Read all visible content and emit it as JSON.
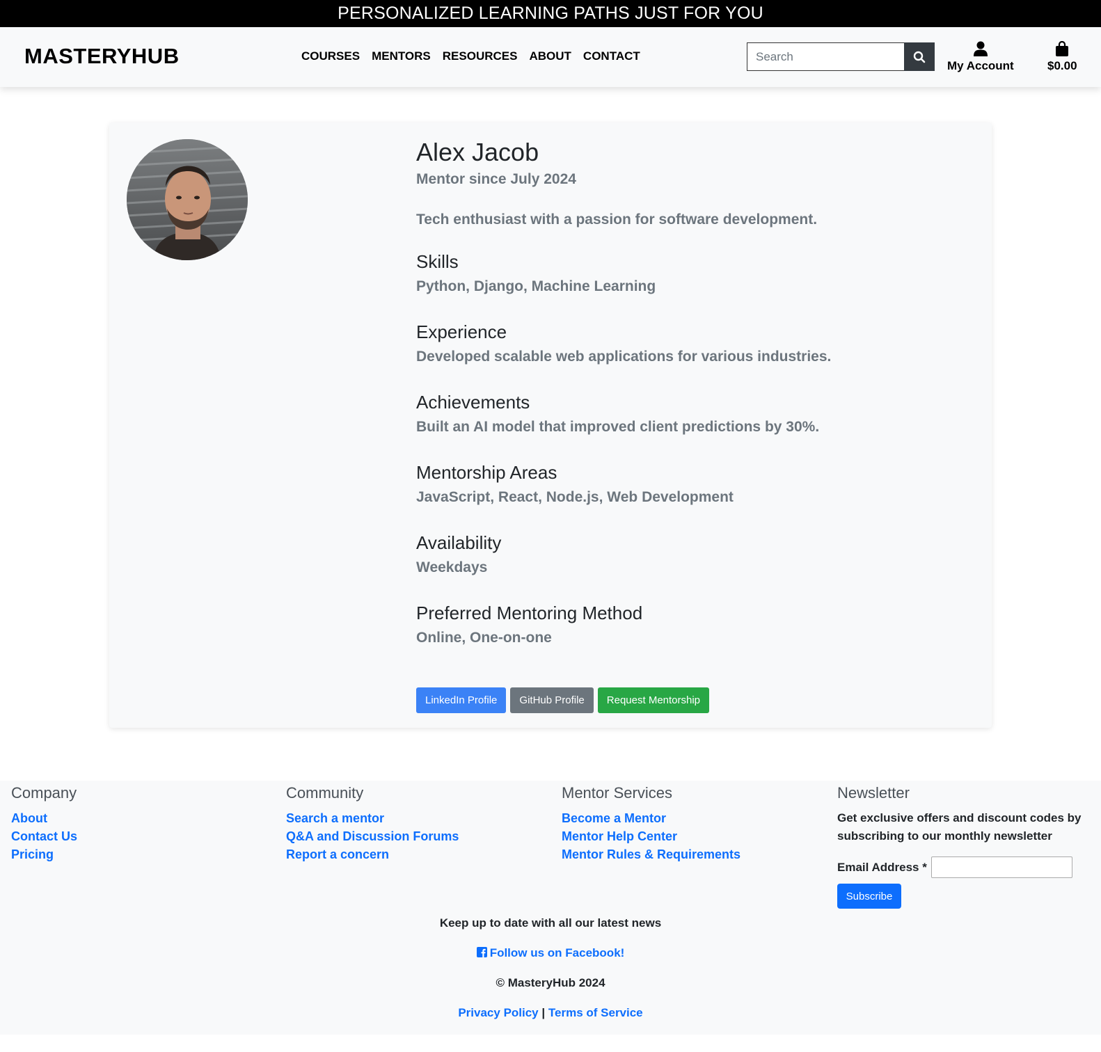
{
  "banner": {
    "text": "PERSONALIZED LEARNING PATHS JUST FOR YOU"
  },
  "header": {
    "brand": "MASTERYHUB",
    "nav": [
      "COURSES",
      "MENTORS",
      "RESOURCES",
      "ABOUT",
      "CONTACT"
    ],
    "search_placeholder": "Search",
    "account_label": "My Account",
    "cart_total": "$0.00"
  },
  "profile": {
    "name": "Alex Jacob",
    "since": "Mentor since July 2024",
    "tagline": "Tech enthusiast with a passion for software development.",
    "sections": [
      {
        "heading": "Skills",
        "value": "Python, Django, Machine Learning"
      },
      {
        "heading": "Experience",
        "value": "Developed scalable web applications for various industries."
      },
      {
        "heading": "Achievements",
        "value": "Built an AI model that improved client predictions by 30%."
      },
      {
        "heading": "Mentorship Areas",
        "value": "JavaScript, React, Node.js, Web Development"
      },
      {
        "heading": "Availability",
        "value": "Weekdays"
      },
      {
        "heading": "Preferred Mentoring Method",
        "value": "Online, One-on-one"
      }
    ],
    "buttons": {
      "linkedin": "LinkedIn Profile",
      "github": "GitHub Profile",
      "request": "Request Mentorship"
    }
  },
  "footer": {
    "company": {
      "title": "Company",
      "links": [
        "About",
        "Contact Us",
        "Pricing"
      ]
    },
    "community": {
      "title": "Community",
      "links": [
        "Search a mentor",
        "Q&A and Discussion Forums",
        "Report a concern"
      ]
    },
    "mentor_services": {
      "title": "Mentor Services",
      "links": [
        "Become a Mentor",
        "Mentor Help Center",
        "Mentor Rules & Requirements"
      ]
    },
    "newsletter": {
      "title": "Newsletter",
      "text": "Get exclusive offers and discount codes by subscribing to our monthly newsletter",
      "email_label": "Email Address *",
      "subscribe": "Subscribe"
    },
    "keep_up": "Keep up to date with all our latest news",
    "facebook": "Follow us on Facebook!",
    "copyright": "© MasteryHub 2024",
    "privacy": "Privacy Policy",
    "separator": "|",
    "terms": "Terms of Service"
  },
  "colors": {
    "primary": "#0d6efd",
    "linkedin_btn": "#3b82f6",
    "github_btn": "#6c757d",
    "request_btn": "#28a745",
    "banner_bg": "#000000"
  }
}
